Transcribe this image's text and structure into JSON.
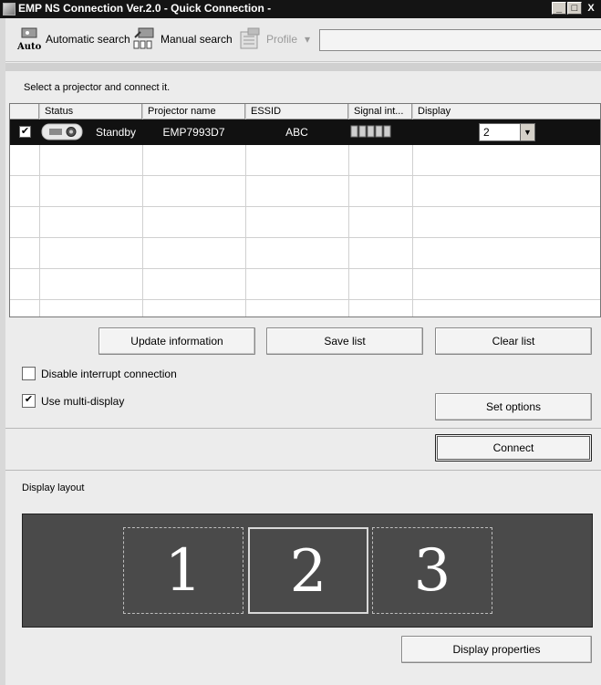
{
  "window": {
    "title": "EMP NS Connection Ver.2.0 - Quick Connection -",
    "controls": [
      "_",
      "□",
      "X"
    ]
  },
  "toolbar": {
    "auto_icon_text": "Auto",
    "automatic_search": "Automatic search",
    "manual_search": "Manual search",
    "profile": "Profile",
    "profile_arrow": "▾"
  },
  "instruction": "Select a projector and connect it.",
  "table": {
    "headers": [
      "Status",
      "Projector name",
      "ESSID",
      "Signal int...",
      "Display"
    ],
    "row": {
      "checked": "✔",
      "status": "Standby",
      "projector_name": "EMP7993D7",
      "essid": "ABC",
      "signal_level": 1.0,
      "display": "2"
    }
  },
  "buttons": {
    "update": "Update information",
    "save": "Save list",
    "clear": "Clear list",
    "set_options": "Set options",
    "connect": "Connect",
    "display_properties": "Display properties"
  },
  "options": {
    "disable_interrupt": {
      "label": "Disable interrupt connection",
      "checked": false
    },
    "multi_display": {
      "label": "Use multi-display",
      "checked": true,
      "mark": "✔"
    }
  },
  "display_layout": {
    "label": "Display layout",
    "screens": [
      "1",
      "2",
      "3"
    ],
    "active": "2"
  },
  "colors": {
    "titlebar": "#141414",
    "selected_row": "#111111",
    "layout_panel": "#4a4a4a",
    "window_bg": "#ececec"
  }
}
